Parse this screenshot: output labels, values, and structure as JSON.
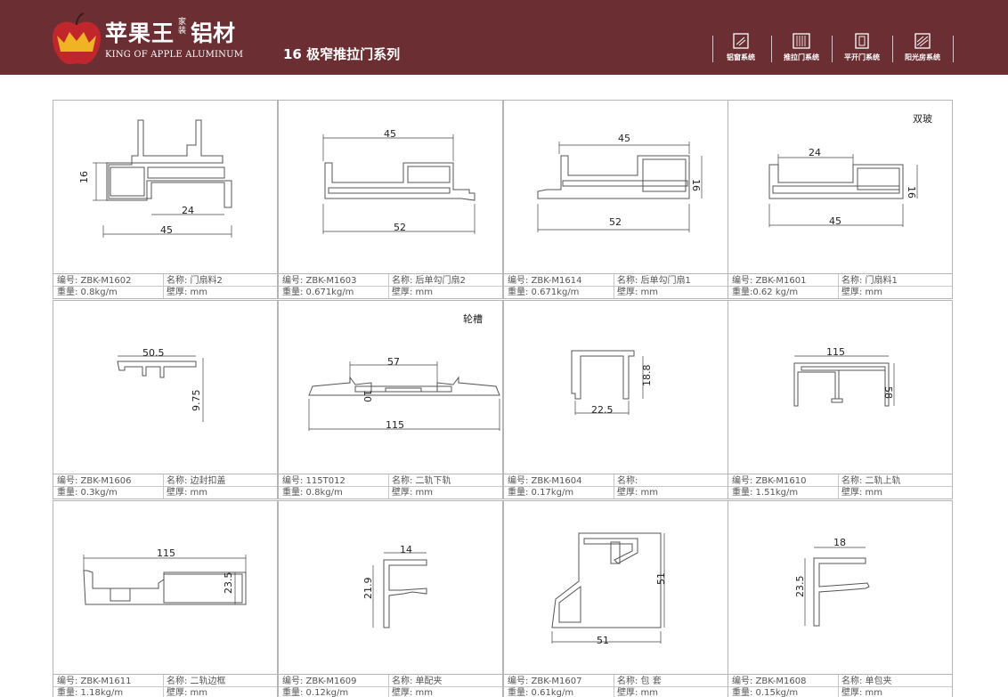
{
  "header": {
    "brand_cn": "苹果王",
    "brand_small": "家装",
    "brand_cn2": "铝材",
    "brand_en": "KING OF APPLE ALUMINUM",
    "series_title": "16 极窄推拉门系列",
    "nav": [
      {
        "label": "铝窗系统",
        "icon": "window-icon"
      },
      {
        "label": "推拉门系统",
        "icon": "sliding-door-icon"
      },
      {
        "label": "平开门系统",
        "icon": "casement-door-icon"
      },
      {
        "label": "阳光房系统",
        "icon": "sunroom-icon"
      }
    ]
  },
  "cells": [
    {
      "code": "编号: ZBK-M1602",
      "name": "名称: 门扇料2",
      "weight": "重量: 0.8kg/m",
      "wall": "壁厚: mm",
      "note": "",
      "dims": [
        "16",
        "24",
        "45"
      ]
    },
    {
      "code": "编号: ZBK-M1603",
      "name": "名称: 后单勾门扇2",
      "weight": "重量: 0.671kg/m",
      "wall": "壁厚: mm",
      "note": "",
      "dims": [
        "45",
        "52"
      ]
    },
    {
      "code": "编号: ZBK-M1614",
      "name": "名称: 后单勾门扇1",
      "weight": "重量: 0.671kg/m",
      "wall": "壁厚: mm",
      "note": "",
      "dims": [
        "45",
        "16",
        "52"
      ]
    },
    {
      "code": "编号: ZBK-M1601",
      "name": "名称: 门扇料1",
      "weight": "重量:0.62 kg/m",
      "wall": "壁厚: mm",
      "note": "双玻",
      "dims": [
        "24",
        "16",
        "45"
      ]
    },
    {
      "code": "编号: ZBK-M1606",
      "name": "名称: 边封扣盖",
      "weight": "重量: 0.3kg/m",
      "wall": "壁厚: mm",
      "note": "",
      "dims": [
        "50.5",
        "9.75"
      ]
    },
    {
      "code": "编号: 115T012",
      "name": "名称: 二轨下轨",
      "weight": "重量: 0.8kg/m",
      "wall": "壁厚: mm",
      "note": "轮槽",
      "dims": [
        "57",
        "10",
        "115"
      ]
    },
    {
      "code": "编号: ZBK-M1604",
      "name": "名称:",
      "weight": "重量: 0.17kg/m",
      "wall": "壁厚: mm",
      "note": "",
      "dims": [
        "18.8",
        "22.5"
      ]
    },
    {
      "code": "编号: ZBK-M1610",
      "name": "名称: 二轨上轨",
      "weight": "重量: 1.51kg/m",
      "wall": "壁厚: mm",
      "note": "",
      "dims": [
        "115",
        "58"
      ]
    },
    {
      "code": "编号: ZBK-M1611",
      "name": "名称: 二轨边框",
      "weight": "重量: 1.18kg/m",
      "wall": "壁厚: mm",
      "note": "",
      "dims": [
        "115",
        "23.5"
      ]
    },
    {
      "code": "编号: ZBK-M1609",
      "name": "名称: 单配夹",
      "weight": "重量: 0.12kg/m",
      "wall": "壁厚: mm",
      "note": "",
      "dims": [
        "14",
        "21.9"
      ]
    },
    {
      "code": "编号: ZBK-M1607",
      "name": "名称: 包 套",
      "weight": "重量: 0.61kg/m",
      "wall": "壁厚: mm",
      "note": "",
      "dims": [
        "51",
        "51"
      ]
    },
    {
      "code": "编号: ZBK-M1608",
      "name": "名称: 单包夹",
      "weight": "重量: 0.15kg/m",
      "wall": "壁厚: mm",
      "note": "",
      "dims": [
        "18",
        "23.5"
      ]
    }
  ],
  "colors": {
    "header_bg": "#6b2f33",
    "logo_apple": "#c0262c",
    "crown": "#f0b323"
  }
}
